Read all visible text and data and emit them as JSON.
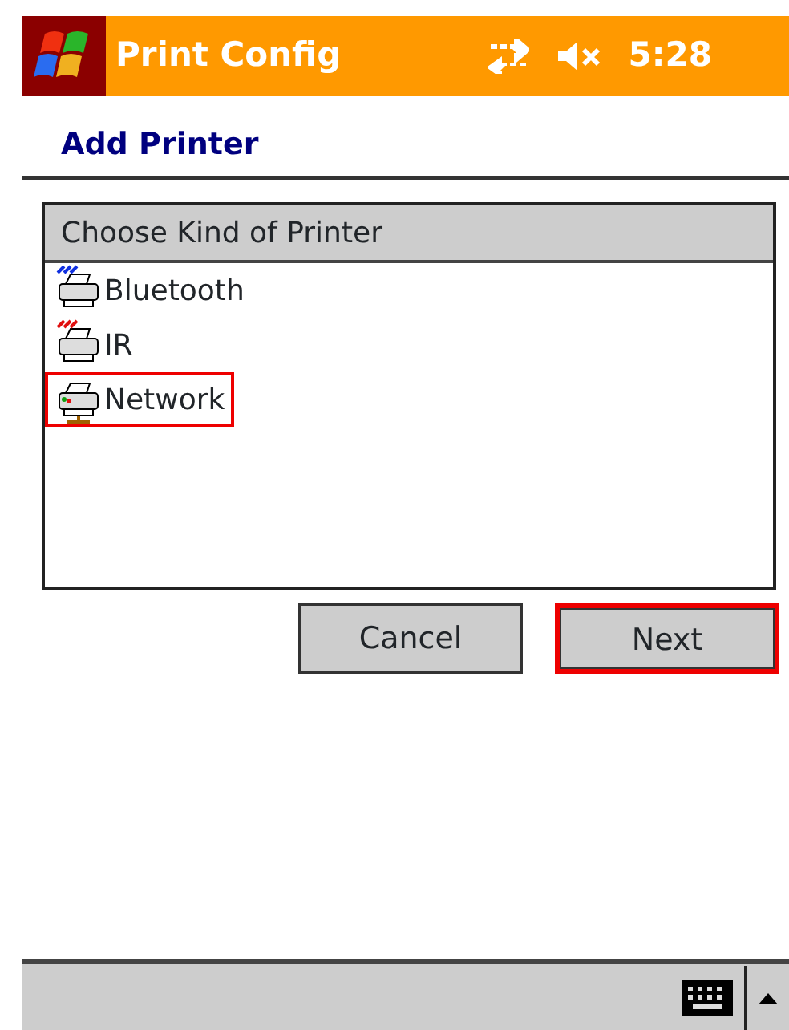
{
  "title_bar": {
    "title": "Print Config",
    "time": "5:28"
  },
  "header": {
    "title": "Add Printer"
  },
  "printer_list": {
    "heading": "Choose Kind of Printer",
    "items": [
      {
        "label": "Bluetooth",
        "kind": "bluetooth",
        "highlighted": false
      },
      {
        "label": "IR",
        "kind": "infrared",
        "highlighted": false
      },
      {
        "label": "Network",
        "kind": "network",
        "highlighted": true
      }
    ]
  },
  "buttons": [
    {
      "label": "Cancel",
      "highlighted": false
    },
    {
      "label": "Next",
      "highlighted": true
    }
  ]
}
